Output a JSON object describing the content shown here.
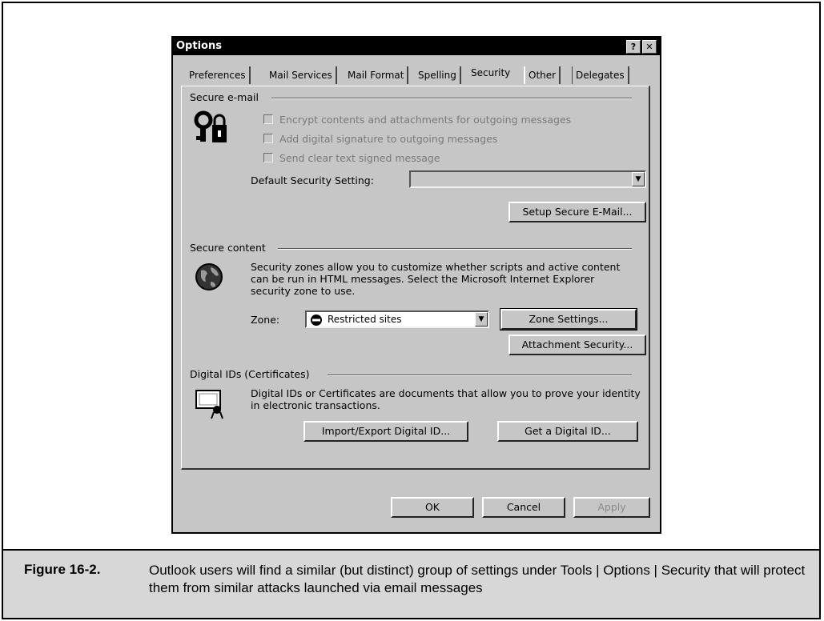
{
  "dialog": {
    "title": "Options",
    "help_button": "?",
    "close_button": "✕",
    "tabs": [
      "Preferences",
      "Mail Services",
      "Mail Format",
      "Spelling",
      "Security",
      "Other",
      "Delegates"
    ],
    "active_tab": "Security"
  },
  "secure_email": {
    "heading": "Secure e-mail",
    "checkboxes": [
      {
        "label": "Encrypt contents and attachments for outgoing messages",
        "checked": false,
        "enabled": false
      },
      {
        "label": "Add digital signature to outgoing messages",
        "checked": false,
        "enabled": false
      },
      {
        "label": "Send clear text signed message",
        "checked": false,
        "enabled": false
      }
    ],
    "default_setting_label": "Default Security Setting:",
    "default_setting_value": "",
    "setup_button": "Setup Secure E-Mail..."
  },
  "secure_content": {
    "heading": "Secure content",
    "description": "Security zones allow you to customize whether scripts and active content can be run in HTML messages.  Select the Microsoft Internet Explorer security zone to use.",
    "zone_label": "Zone:",
    "zone_value": "Restricted sites",
    "zone_settings_button": "Zone Settings...",
    "attachment_security_button": "Attachment Security..."
  },
  "digital_ids": {
    "heading": "Digital IDs (Certificates)",
    "description": "Digital IDs or Certificates are documents that allow you to prove your identity in electronic transactions.",
    "import_export_button": "Import/Export Digital ID...",
    "get_id_button": "Get a Digital ID..."
  },
  "footer_buttons": {
    "ok": "OK",
    "cancel": "Cancel",
    "apply": "Apply"
  },
  "caption": {
    "label": "Figure 16-2.",
    "text": "Outlook users will find a similar (but distinct) group of settings under Tools | Options | Security that will protect them from similar attacks launched via email messages"
  },
  "colors": {
    "dialog_bg": "#c6c6c6",
    "titlebar": "#000000",
    "caption_bg": "#d7d7d7"
  }
}
